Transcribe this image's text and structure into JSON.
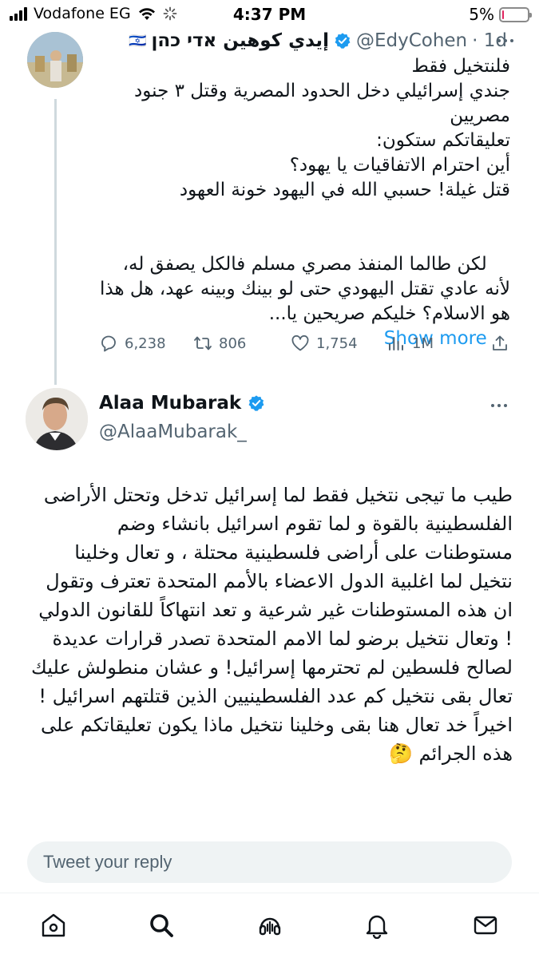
{
  "status_bar": {
    "carrier": "Vodafone EG",
    "time": "4:37 PM",
    "battery_percent": "5%",
    "battery_level": 0.05,
    "battery_color": "#e0245e"
  },
  "tweet1": {
    "flag": "🇮🇱",
    "name": "إيدي كوهين אדי כהן",
    "handle": "@EdyCohen",
    "age": "· 1d",
    "lines": [
      "فلنتخيل فقط",
      "جندي إسرائيلي دخل الحدود المصرية وقتل ٣ جنود مصريين",
      "تعليقاتكم ستكون:",
      "أين احترام الاتفاقيات يا يهود؟",
      "قتل غيلة! حسبي الله في اليهود خونة العهود",
      "",
      "لكن طالما المنفذ مصري مسلم فالكل يصفق له، لأنه عادي تقتل اليهودي حتى لو بينك وبينه عهد، هل هذا هو الاسلام؟ خليكم صريحين يا..."
    ],
    "show_more": "Show more",
    "stats": {
      "replies": "6,238",
      "retweets": "806",
      "likes": "1,754",
      "views": "1M"
    }
  },
  "tweet2": {
    "name": "Alaa Mubarak",
    "handle": "@AlaaMubarak_",
    "text": "طيب ما تيجى نتخيل فقط لما إسرائيل تدخل وتحتل الأراضى الفلسطينية بالقوة و لما تقوم اسرائيل بانشاء وضم مستوطنات على أراضى فلسطينية محتلة ، و تعال وخلينا نتخيل لما اغلبية الدول الاعضاء بالأمم المتحدة تعترف وتقول ان هذه المستوطنات غير شرعية و تعد انتهاكاً للقانون الدولي ! وتعال نتخيل برضو لما الامم المتحدة تصدر قرارات عديدة لصالح فلسطين لم تحترمها إسرائيل! و عشان منطولش عليك تعال بقى نتخيل كم عدد الفلسطينيين الذين قتلتهم اسرائيل ! اخيراً خد تعال هنا بقى وخلينا نتخيل ماذا يكون تعليقاتكم على هذه الجرائم 🤔"
  },
  "reply": {
    "placeholder": "Tweet your reply"
  },
  "tabs": [
    "home-icon",
    "search-icon",
    "spaces-icon",
    "notifications-icon",
    "messages-icon"
  ],
  "colors": {
    "accent": "#1d9bf0",
    "text": "#0f1419",
    "secondary": "#536471"
  }
}
